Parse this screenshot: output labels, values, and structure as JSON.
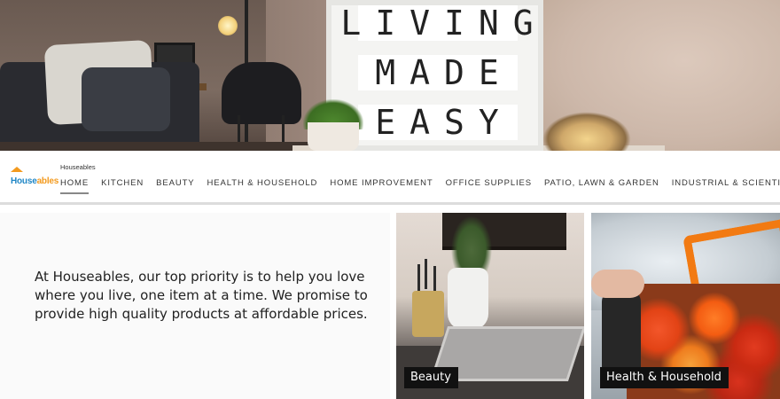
{
  "hero": {
    "lightbox_lines": [
      [
        "L",
        "I",
        "V",
        "I",
        "N",
        "G"
      ],
      [
        "M",
        "A",
        "D",
        "E"
      ],
      [
        "E",
        "A",
        "S",
        "Y"
      ]
    ]
  },
  "brand": {
    "logo_part1": "House",
    "logo_part2": "ables",
    "name": "Houseables"
  },
  "nav": {
    "items": [
      {
        "label": "HOME",
        "active": true
      },
      {
        "label": "KITCHEN",
        "active": false
      },
      {
        "label": "BEAUTY",
        "active": false
      },
      {
        "label": "HEALTH & HOUSEHOLD",
        "active": false
      },
      {
        "label": "HOME IMPROVEMENT",
        "active": false
      },
      {
        "label": "OFFICE SUPPLIES",
        "active": false
      },
      {
        "label": "PATIO, LAWN & GARDEN",
        "active": false
      },
      {
        "label": "INDUSTRIAL & SCIENTIFIC",
        "active": false
      }
    ]
  },
  "mission": {
    "text": "At Houseables, our top priority is to help you love where you live, one item at a time. We promise to provide high quality products at affordable prices."
  },
  "tiles": [
    {
      "label": "Beauty"
    },
    {
      "label": "Health & Household"
    }
  ],
  "colors": {
    "logo_blue": "#1f86c5",
    "logo_orange": "#f39a1e",
    "label_bg": "#111111"
  }
}
